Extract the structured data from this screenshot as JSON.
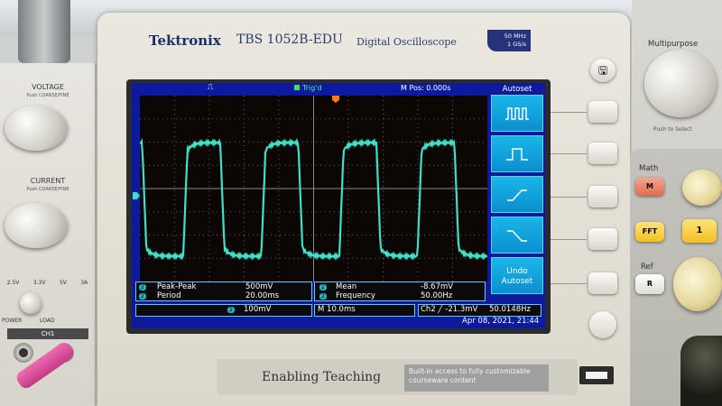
{
  "device": {
    "brand": "Tektronix",
    "model": "TBS 1052B-EDU",
    "description": "Digital Oscilloscope",
    "spec_line1": "50 MHz",
    "spec_line2": "1 GS/s"
  },
  "status_bar": {
    "trigger": "Trig'd",
    "m_pos": "M Pos: 0.000s"
  },
  "side_menu": {
    "title": "Autoset",
    "items": [
      {
        "icon": "square-wave-icon"
      },
      {
        "icon": "single-pulse-icon"
      },
      {
        "icon": "rising-edge-icon"
      },
      {
        "icon": "falling-edge-icon"
      },
      {
        "label": "Undo Autoset"
      }
    ]
  },
  "measurements": {
    "m1_name": "Peak-Peak",
    "m1_value": "500mV",
    "m2_name": "Period",
    "m2_value": "20.00ms",
    "m3_name": "Mean",
    "m3_value": "-8.67mV",
    "m4_name": "Frequency",
    "m4_value": "50.00Hz"
  },
  "status_row": {
    "ch_scale": "100mV",
    "timebase": "M 10.0ms",
    "trigger_info": "Ch2 ╱ -21.3mV",
    "trigger_freq": "50.0148Hz",
    "datetime": "Apr 08, 2021, 21:44"
  },
  "right_panel": {
    "multipurpose": "Multipurpose",
    "push_select": "Push to Select",
    "math": "Math",
    "math_btn": "M",
    "fft_btn": "FFT",
    "one_btn": "1",
    "ref": "Ref",
    "ref_btn": "R"
  },
  "power_supply": {
    "voltage": "VOLTAGE",
    "voltage_sub": "Push COARSE/FINE",
    "current": "CURRENT",
    "current_sub": "Push COARSE/FINE",
    "tab1": "2.5V",
    "tab2": "3.3V",
    "tab3": "5V",
    "tab4": "3A",
    "load": "LOAD",
    "power": "POWER",
    "channel": "CH1"
  },
  "footer": {
    "title": "Enabling Teaching",
    "desc": "Built-in access to fully customizable courseware content"
  },
  "colors": {
    "trace": "#3fe0c8",
    "screen_blue": "#0e1a9c",
    "menu_cyan": "#1bb6e8"
  }
}
